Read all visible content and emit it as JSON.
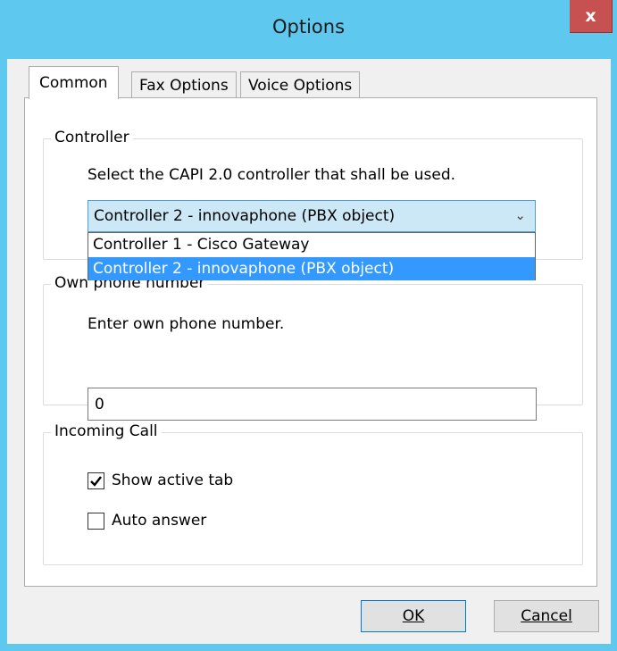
{
  "window": {
    "title": "Options",
    "close_label": "x"
  },
  "tabs": [
    {
      "label": "Common",
      "active": true
    },
    {
      "label": "Fax Options",
      "active": false
    },
    {
      "label": "Voice Options",
      "active": false
    }
  ],
  "controller": {
    "group_label": "Controller",
    "description": "Select the CAPI 2.0 controller that shall be used.",
    "selected_value": "Controller 2 - innovaphone (PBX object)",
    "options": [
      "Controller 1 - Cisco Gateway",
      "Controller 2 - innovaphone (PBX object)"
    ],
    "highlighted_index": 1
  },
  "phone": {
    "group_label": "Own phone number",
    "description": "Enter own phone number.",
    "value": "0"
  },
  "incoming": {
    "group_label": "Incoming Call",
    "show_active_tab": {
      "label": "Show active tab",
      "checked": true
    },
    "auto_answer": {
      "label": "Auto answer",
      "checked": false
    }
  },
  "buttons": {
    "ok_label": "OK",
    "cancel_label": "Cancel"
  }
}
